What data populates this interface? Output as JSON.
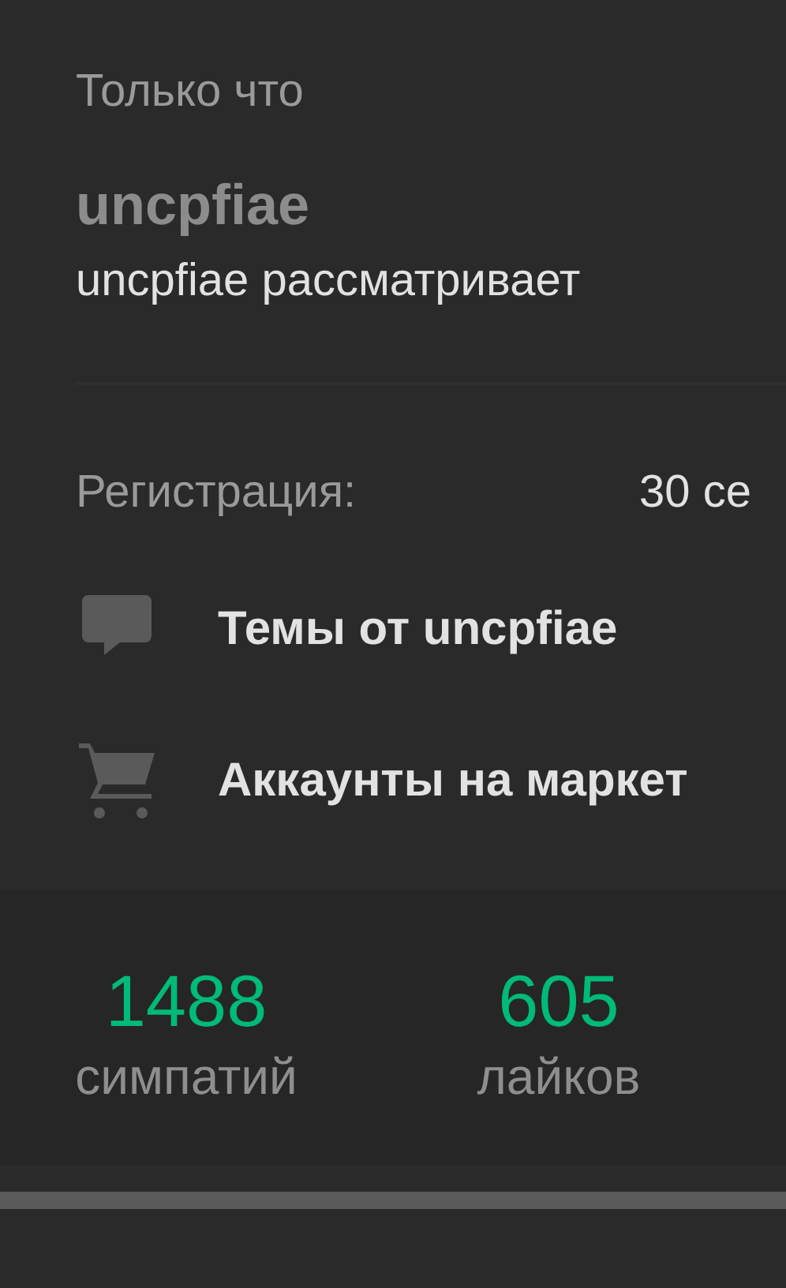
{
  "time": "Только что",
  "username": "uncpfiae",
  "status": "uncpfiae рассматривает",
  "info": [
    {
      "label": "Регистрация:",
      "value": "30 се"
    }
  ],
  "links": [
    {
      "kind": "threads",
      "label": "Темы от uncpfiae"
    },
    {
      "kind": "market",
      "label": "Аккаунты на маркет"
    }
  ],
  "stats": [
    {
      "value": "1488",
      "label": "симпатий"
    },
    {
      "value": "605",
      "label": "лайков"
    }
  ]
}
